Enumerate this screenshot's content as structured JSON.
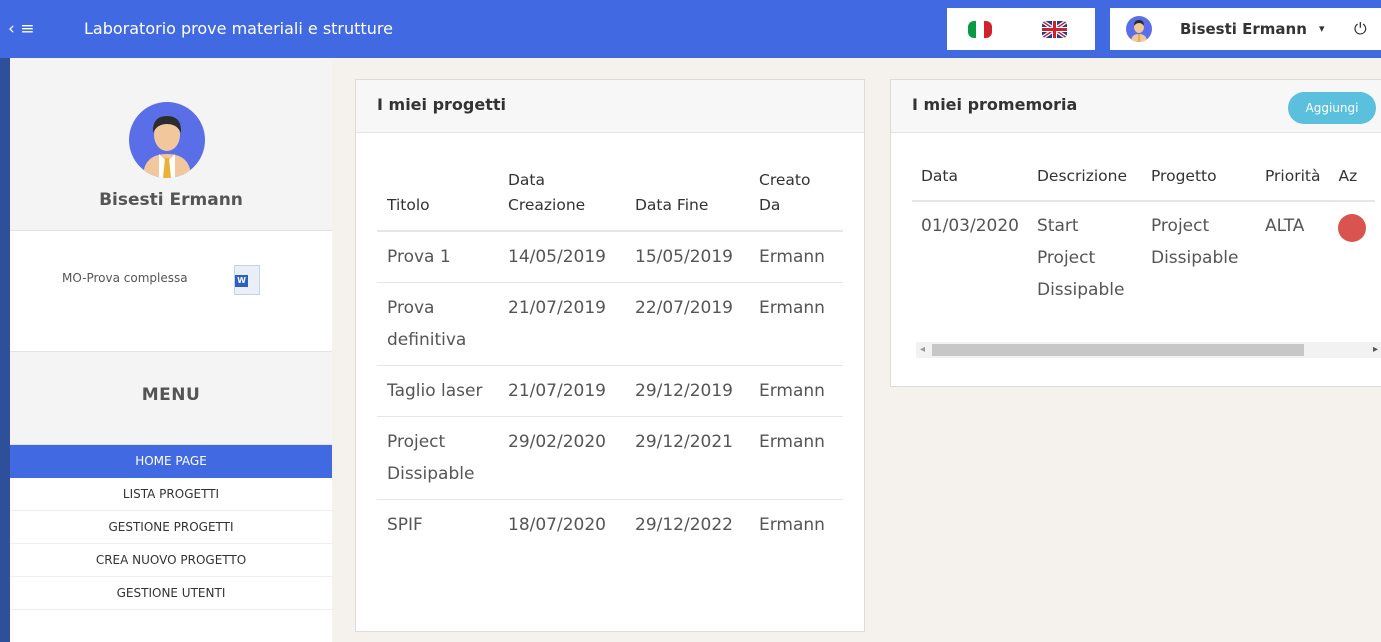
{
  "app": {
    "title": "Laboratorio prove materiali e strutture",
    "menu_toggle": "‹ ≡"
  },
  "header": {
    "user_name": "Bisesti Ermann",
    "caret": "▾",
    "power": "⏻"
  },
  "icons": [
    "menu-toggle-icon",
    "italy-flag-icon",
    "uk-flag-icon",
    "user-avatar-icon",
    "power-icon",
    "word-document-icon"
  ],
  "colors": {
    "topbar": "#4169e1",
    "active_menu": "#4169e1",
    "add_button": "#5bc0de",
    "action_button": "#d9534f"
  },
  "profile": {
    "name": "Bisesti Ermann",
    "file_name": "MO-Prova complessa",
    "file_icon_letter": "W"
  },
  "menu": {
    "title": "MENU",
    "items": [
      {
        "label": "HOME PAGE",
        "active": true
      },
      {
        "label": "LISTA PROGETTI"
      },
      {
        "label": "GESTIONE PROGETTI"
      },
      {
        "label": "CREA NUOVO PROGETTO"
      },
      {
        "label": "GESTIONE UTENTI"
      }
    ]
  },
  "projects": {
    "title": "I miei progetti",
    "columns": [
      "Titolo",
      "Data Creazione",
      "Data Fine",
      "Creato Da"
    ],
    "rows": [
      [
        "Prova 1",
        "14/05/2019",
        "15/05/2019",
        "Ermann"
      ],
      [
        "Prova definitiva",
        "21/07/2019",
        "22/07/2019",
        "Ermann"
      ],
      [
        "Taglio laser",
        "21/07/2019",
        "29/12/2019",
        "Ermann"
      ],
      [
        "Project Dissipable",
        "29/02/2020",
        "29/12/2021",
        "Ermann"
      ],
      [
        "SPIF",
        "18/07/2020",
        "29/12/2022",
        "Ermann"
      ]
    ]
  },
  "reminders": {
    "title": "I miei promemoria",
    "add_label": "Aggiungi",
    "columns": [
      "Data",
      "Descrizione",
      "Progetto",
      "Priorità",
      "Az"
    ],
    "rows": [
      [
        "01/03/2020",
        "Start Project Dissipable",
        "Project Dissipable",
        "ALTA"
      ]
    ],
    "scroll_left": "◂",
    "scroll_right": "▸"
  }
}
